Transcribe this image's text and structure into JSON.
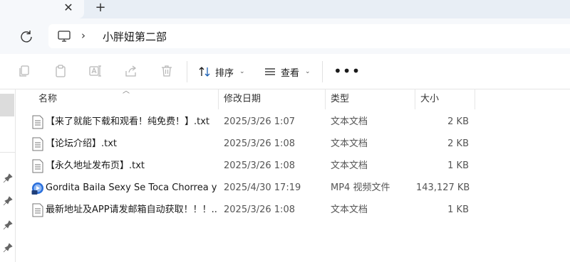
{
  "tab": {
    "close_symbol": "✕",
    "new_tab_symbol": "+"
  },
  "address": {
    "chevron": "›",
    "crumb": "小胖妞第二部"
  },
  "toolbar": {
    "sort_label": "排序",
    "view_label": "查看",
    "more_label": "•••",
    "icons": [
      "copy-icon",
      "paste-icon",
      "rename-icon",
      "share-icon",
      "delete-icon"
    ]
  },
  "columns": {
    "name": "名称",
    "date": "修改日期",
    "type": "类型",
    "size": "大小"
  },
  "files": [
    {
      "name": "【来了就能下载和观看！纯免费！】.txt",
      "date": "2025/3/26 1:07",
      "type": "文本文档",
      "size": "2 KB",
      "icon": "text-file-icon"
    },
    {
      "name": "【论坛介绍】.txt",
      "date": "2025/3/26 1:08",
      "type": "文本文档",
      "size": "2 KB",
      "icon": "text-file-icon"
    },
    {
      "name": "【永久地址发布页】.txt",
      "date": "2025/3/26 1:08",
      "type": "文本文档",
      "size": "1 KB",
      "icon": "text-file-icon"
    },
    {
      "name": "Gordita Baila Sexy Se Toca Chorrea y ...",
      "date": "2025/4/30 17:19",
      "type": "MP4 视频文件",
      "size": "143,127 KB",
      "icon": "video-file-icon"
    },
    {
      "name": "最新地址及APP请发邮箱自动获取！！！...",
      "date": "2025/3/26 1:08",
      "type": "文本文档",
      "size": "1 KB",
      "icon": "text-file-icon"
    }
  ],
  "colors": {
    "tabstrip": "#e8eef5",
    "address_bar_bg": "#f6f8fb",
    "video_icon": "#2a6fdb"
  }
}
